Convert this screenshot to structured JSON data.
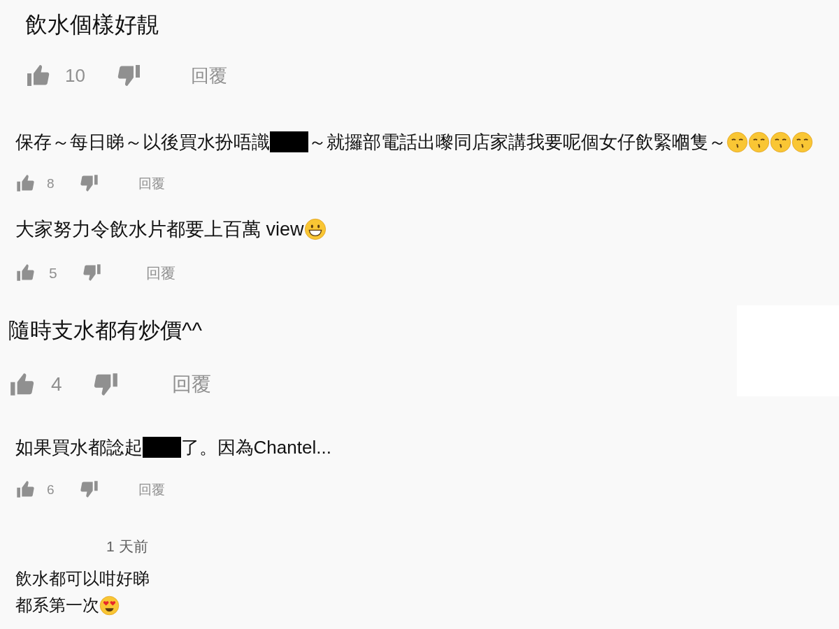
{
  "comments": [
    {
      "lines": [
        [
          {
            "kind": "text",
            "text": "飲水個樣好靚"
          }
        ]
      ],
      "likes": "10",
      "reply": "回覆"
    },
    {
      "lines": [
        [
          {
            "kind": "text",
            "text": "保存～每日睇～以後買水扮唔識"
          },
          {
            "kind": "redaction"
          },
          {
            "kind": "text",
            "text": "～就攞部電話出嚟同店家講我要呢個女仔飲緊嗰隻～"
          },
          {
            "kind": "kiss-emoji"
          },
          {
            "kind": "kiss-emoji"
          },
          {
            "kind": "kiss-emoji"
          },
          {
            "kind": "kiss-emoji"
          }
        ]
      ],
      "likes": "8",
      "reply": "回覆"
    },
    {
      "lines": [
        [
          {
            "kind": "text",
            "text": "大家努力令飲水片都要上百萬 view"
          },
          {
            "kind": "grin-emoji"
          }
        ]
      ],
      "likes": "5",
      "reply": "回覆"
    },
    {
      "lines": [
        [
          {
            "kind": "text",
            "text": "隨時支水都有炒價^^"
          }
        ]
      ],
      "likes": "4",
      "reply": "回覆"
    },
    {
      "lines": [
        [
          {
            "kind": "text",
            "text": "如果買水都諗起"
          },
          {
            "kind": "redaction"
          },
          {
            "kind": "text",
            "text": "了。因為Chantel..."
          }
        ]
      ],
      "likes": "6",
      "reply": "回覆"
    },
    {
      "time": "1 天前",
      "lines": [
        [
          {
            "kind": "text",
            "text": "飲水都可以咁好睇"
          }
        ],
        [
          {
            "kind": "text",
            "text": "都系第一次"
          },
          {
            "kind": "heart-eyes-emoji"
          }
        ]
      ]
    }
  ]
}
